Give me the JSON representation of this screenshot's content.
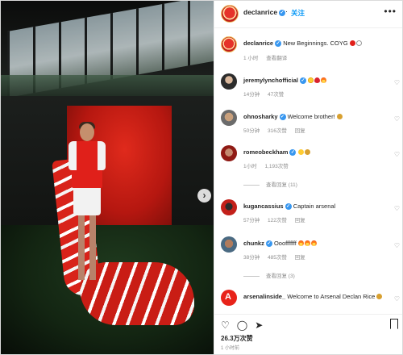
{
  "post": {
    "username": "declanrice",
    "follow_label": "关注",
    "more_label": "•••",
    "caption_text": "New Beginnings. COYG",
    "caption_time": "1 小时",
    "caption_translate": "查看翻译"
  },
  "comments": [
    {
      "username": "jeremylynchofficial",
      "text": "",
      "time": "14分钟",
      "likes": "47次赞",
      "emoji": [
        "e-star",
        "e-heart",
        "e-fire"
      ],
      "replies": ""
    },
    {
      "username": "ohnosharky",
      "text": "Welcome brother!",
      "time": "50分钟",
      "likes": "316次赞",
      "reply": "回复",
      "emoji_after": [
        "e-face"
      ],
      "replies": ""
    },
    {
      "username": "romeobeckham",
      "text": "",
      "time": "1小时",
      "likes": "1,193次赞",
      "emoji": [
        "e-smile",
        "e-face"
      ],
      "replies": "查看回复 (11)"
    },
    {
      "username": "kugancassius",
      "text": "Captain arsenal",
      "time": "57分钟",
      "likes": "122次赞",
      "reply": "回复",
      "replies": ""
    },
    {
      "username": "chunkz",
      "text": "Ooofffffff",
      "time": "38分钟",
      "likes": "485次赞",
      "reply": "回复",
      "emoji_after": [
        "e-fire",
        "e-fire",
        "e-fire"
      ],
      "replies": "查看回复 (3)"
    },
    {
      "username": "arsenalinside_",
      "text": "Welcome to Arsenal Declan Rice",
      "time": "",
      "likes": "",
      "emoji_after": [
        "e-face"
      ],
      "replies": ""
    }
  ],
  "footer": {
    "likes": "26.3万次赞",
    "time": "1 小时前"
  },
  "colors": {
    "accent": "#0095f6",
    "verified": "#3897f0",
    "arsenal_red": "#e0201a"
  }
}
